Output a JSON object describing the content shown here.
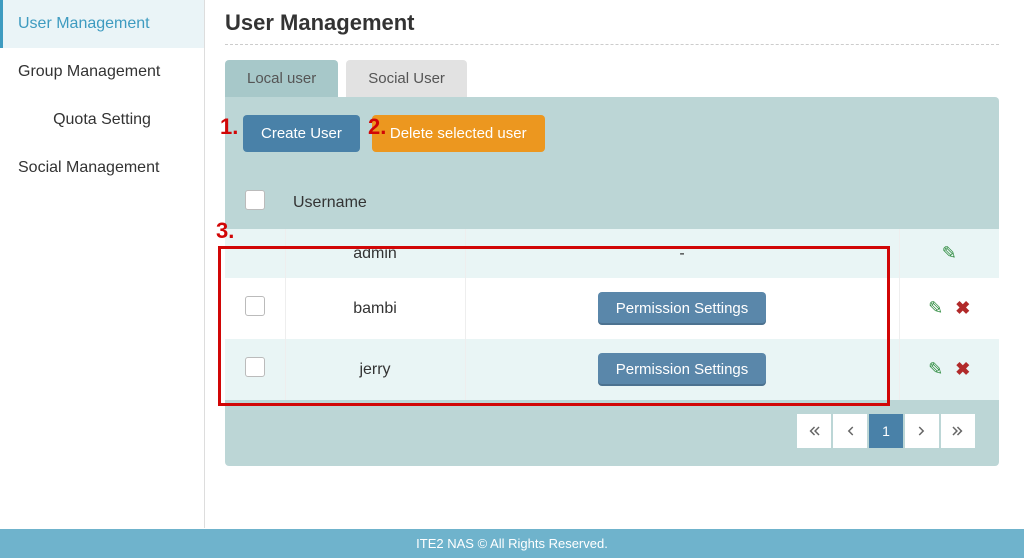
{
  "sidebar": {
    "items": [
      {
        "label": "User Management",
        "active": true
      },
      {
        "label": "Group Management",
        "active": false
      },
      {
        "label": "Quota Setting",
        "active": false
      },
      {
        "label": "Social Management",
        "active": false
      }
    ]
  },
  "header": {
    "title": "User Management"
  },
  "tabs": [
    {
      "label": "Local user",
      "active": true
    },
    {
      "label": "Social User",
      "active": false
    }
  ],
  "toolbar": {
    "create_label": "Create User",
    "delete_label": "Delete selected user"
  },
  "table": {
    "headers": {
      "username": "Username"
    },
    "rows": [
      {
        "username": "admin",
        "permission_label": "-",
        "has_perm_button": false,
        "can_delete": false
      },
      {
        "username": "bambi",
        "permission_label": "Permission Settings",
        "has_perm_button": true,
        "can_delete": true
      },
      {
        "username": "jerry",
        "permission_label": "Permission Settings",
        "has_perm_button": true,
        "can_delete": true
      }
    ]
  },
  "pager": {
    "current": "1"
  },
  "footer": {
    "text": "ITE2 NAS © All Rights Reserved."
  },
  "annotations": {
    "a1": "1.",
    "a2": "2.",
    "a3": "3."
  }
}
